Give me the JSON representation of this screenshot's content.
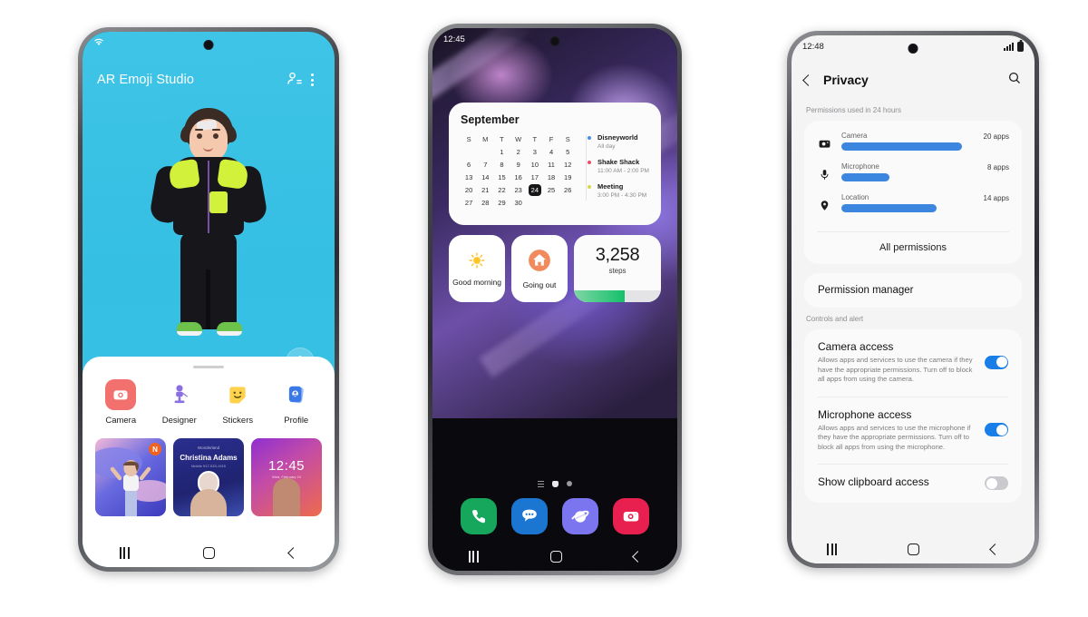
{
  "phone1": {
    "status": {
      "wifi": "wifi-icon"
    },
    "appbar": {
      "title": "AR Emoji Studio",
      "icons": [
        "add-person-icon",
        "more-options-icon"
      ]
    },
    "fab": "avatar-pose-icon",
    "apps": [
      {
        "label": "Camera",
        "icon": "camera-icon",
        "color": "#f26d6d"
      },
      {
        "label": "Designer",
        "icon": "designer-icon",
        "color": "#8b6fe0"
      },
      {
        "label": "Stickers",
        "icon": "stickers-icon",
        "color": "#ffd24d"
      },
      {
        "label": "Profile",
        "icon": "profile-icon",
        "color": "#3b79e8"
      }
    ],
    "cards": {
      "card1": {
        "badge": "N"
      },
      "card2": {
        "subtitle": "Wonderland",
        "name": "Christina Adams",
        "meta": "Mobile  917-533-1915"
      },
      "card3": {
        "time": "12:45",
        "date": "Wed, February 24",
        "dots": "••••"
      }
    },
    "nav": [
      "recents-button",
      "home-button",
      "back-button"
    ]
  },
  "phone2": {
    "status": {
      "time": "12:45"
    },
    "calendar": {
      "month": "September",
      "dow": [
        "S",
        "M",
        "T",
        "W",
        "T",
        "F",
        "S"
      ],
      "weeks": [
        [
          "",
          "",
          "1",
          "2",
          "3",
          "4",
          "5"
        ],
        [
          "6",
          "7",
          "8",
          "9",
          "10",
          "11",
          "12"
        ],
        [
          "13",
          "14",
          "15",
          "16",
          "17",
          "18",
          "19"
        ],
        [
          "20",
          "21",
          "22",
          "23",
          "24",
          "25",
          "26"
        ],
        [
          "27",
          "28",
          "29",
          "30",
          "",
          "",
          ""
        ]
      ],
      "today": "24",
      "events": [
        {
          "title": "Disneyworld",
          "time": "All day",
          "color": "#4a90e2"
        },
        {
          "title": "Shake Shack",
          "time": "11:00 AM - 2:00 PM",
          "color": "#e8506b"
        },
        {
          "title": "Meeting",
          "time": "3:00 PM - 4:30 PM",
          "color": "#d6d94a"
        }
      ]
    },
    "widgets": {
      "routine1": {
        "label": "Good morning",
        "icon": "sun-icon"
      },
      "routine2": {
        "label": "Going out",
        "icon": "home-icon"
      },
      "steps": {
        "value": "3,258",
        "label": "steps",
        "progress_pct": 58
      }
    },
    "page_indicator": [
      "app-list-indicator",
      "home-page-indicator",
      "page-dot-indicator"
    ],
    "dock": [
      {
        "name": "Phone",
        "icon": "phone-icon",
        "color": "#16a75c"
      },
      {
        "name": "Messages",
        "icon": "messages-icon",
        "color": "#1b76d2"
      },
      {
        "name": "Internet",
        "icon": "internet-icon",
        "color": "#7b76ef"
      },
      {
        "name": "Camera",
        "icon": "camera-icon",
        "color": "#e8204f"
      }
    ],
    "nav": [
      "recents-button",
      "home-button",
      "back-button"
    ]
  },
  "phone3": {
    "status": {
      "time": "12:48",
      "signal": "signal-icon",
      "battery": "battery-icon"
    },
    "appbar": {
      "title": "Privacy",
      "back": "back-icon",
      "search": "search-icon"
    },
    "permissions_header": "Permissions used in 24 hours",
    "permissions": [
      {
        "name": "Camera",
        "count": "20 apps",
        "icon": "camera-icon",
        "bar_pct": 100
      },
      {
        "name": "Microphone",
        "count": "8 apps",
        "icon": "microphone-icon",
        "bar_pct": 40
      },
      {
        "name": "Location",
        "count": "14 apps",
        "icon": "location-icon",
        "bar_pct": 79
      }
    ],
    "all_permissions": "All permissions",
    "permission_manager": "Permission manager",
    "controls_label": "Controls and alert",
    "controls": [
      {
        "title": "Camera access",
        "desc": "Allows apps and services to use the camera if they have the appropriate permissions. Turn off to block all apps from using the camera.",
        "toggle": "on"
      },
      {
        "title": "Microphone access",
        "desc": "Allows apps and services to use the microphone if they have the appropriate permissions. Turn off to block all apps from using the microphone.",
        "toggle": "on"
      },
      {
        "title": "Show clipboard access",
        "desc": "",
        "toggle": "off"
      }
    ],
    "nav": [
      "recents-button",
      "home-button",
      "back-button"
    ]
  }
}
